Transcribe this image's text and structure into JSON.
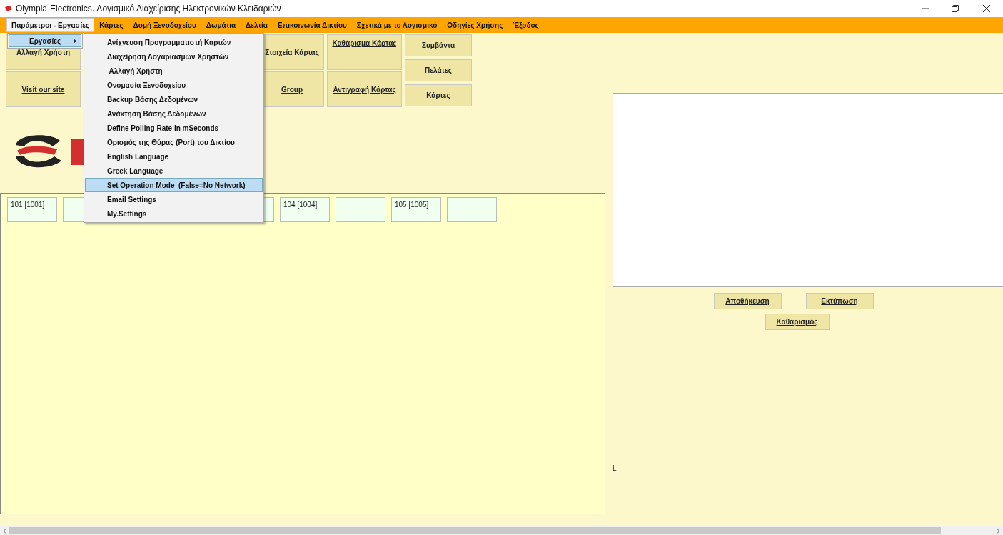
{
  "window": {
    "title": "Olympia-Electronics.  Λογισμικό Διαχείρισης Ηλεκτρονικών Κλειδαριών"
  },
  "menu_bar": [
    {
      "label": "Παράμετροι - Εργασίες",
      "selected": true
    },
    {
      "label": "Κάρτες",
      "selected": false
    },
    {
      "label": "Δομή Ξενοδοχείου",
      "selected": false
    },
    {
      "label": "Δωμάτια",
      "selected": false
    },
    {
      "label": "Δελτία",
      "selected": false
    },
    {
      "label": "Επικοινωνία Δικτίου",
      "selected": false
    },
    {
      "label": "Σχετικά με το Λογισμικό",
      "selected": false
    },
    {
      "label": "Οδηγίες Χρήσης",
      "selected": false
    },
    {
      "label": "Έξοδος",
      "selected": false
    }
  ],
  "open_menu": {
    "items": [
      {
        "label": "Εργασίες",
        "selected": true
      }
    ]
  },
  "submenu": {
    "items": [
      {
        "label": "Ανίχνευση Προγραμματιστή Καρτών",
        "selected": false
      },
      {
        "label": "Διαχείρηση Λογαριασμών Χρηστών",
        "selected": false
      },
      {
        "label": " Αλλαγή Χρήστη",
        "selected": false
      },
      {
        "label": "Ονομασία Ξενοδοχείου",
        "selected": false
      },
      {
        "label": "Backup Βάσης Δεδομένων",
        "selected": false
      },
      {
        "label": "Ανάκτηση Βάσης Δεδομένων",
        "selected": false
      },
      {
        "label": "Define Polling Rate in mSeconds",
        "selected": false
      },
      {
        "label": "Ορισμός της Θύρας (Port) του Δικτίου",
        "selected": false
      },
      {
        "label": "English Language",
        "selected": false
      },
      {
        "label": "Greek Language",
        "selected": false
      },
      {
        "label": "Set Operation Mode  (False=No Network)",
        "selected": true
      },
      {
        "label": "Email Settings",
        "selected": false
      },
      {
        "label": "My.Settings",
        "selected": false
      }
    ]
  },
  "toolbar": {
    "column_1": [
      "Αλλαγή Χρήστη",
      "Visit our site"
    ],
    "column_2": [
      "Στοιχεία Κάρτας",
      "Group"
    ],
    "column_3": [
      "Καθάρισμα Κάρτας",
      "Αντιγραφή Κάρτας"
    ],
    "column_4": [
      "Συμβάντα",
      "Πελάτες",
      "Κάρτες"
    ]
  },
  "rooms_left": [
    {
      "kind": "labeled",
      "label": "101 [1001]"
    },
    {
      "kind": "empty"
    }
  ],
  "rooms": [
    {
      "kind": "empty"
    },
    {
      "kind": "labeled",
      "label": "104 [1004]"
    },
    {
      "kind": "empty"
    },
    {
      "kind": "labeled",
      "label": "105 [1005]"
    },
    {
      "kind": "empty"
    }
  ],
  "right_panel": {
    "buttons": [
      "Αποθήκευση",
      "Εκτύπωση",
      "Καθαρισμός"
    ],
    "status_text": "L"
  }
}
